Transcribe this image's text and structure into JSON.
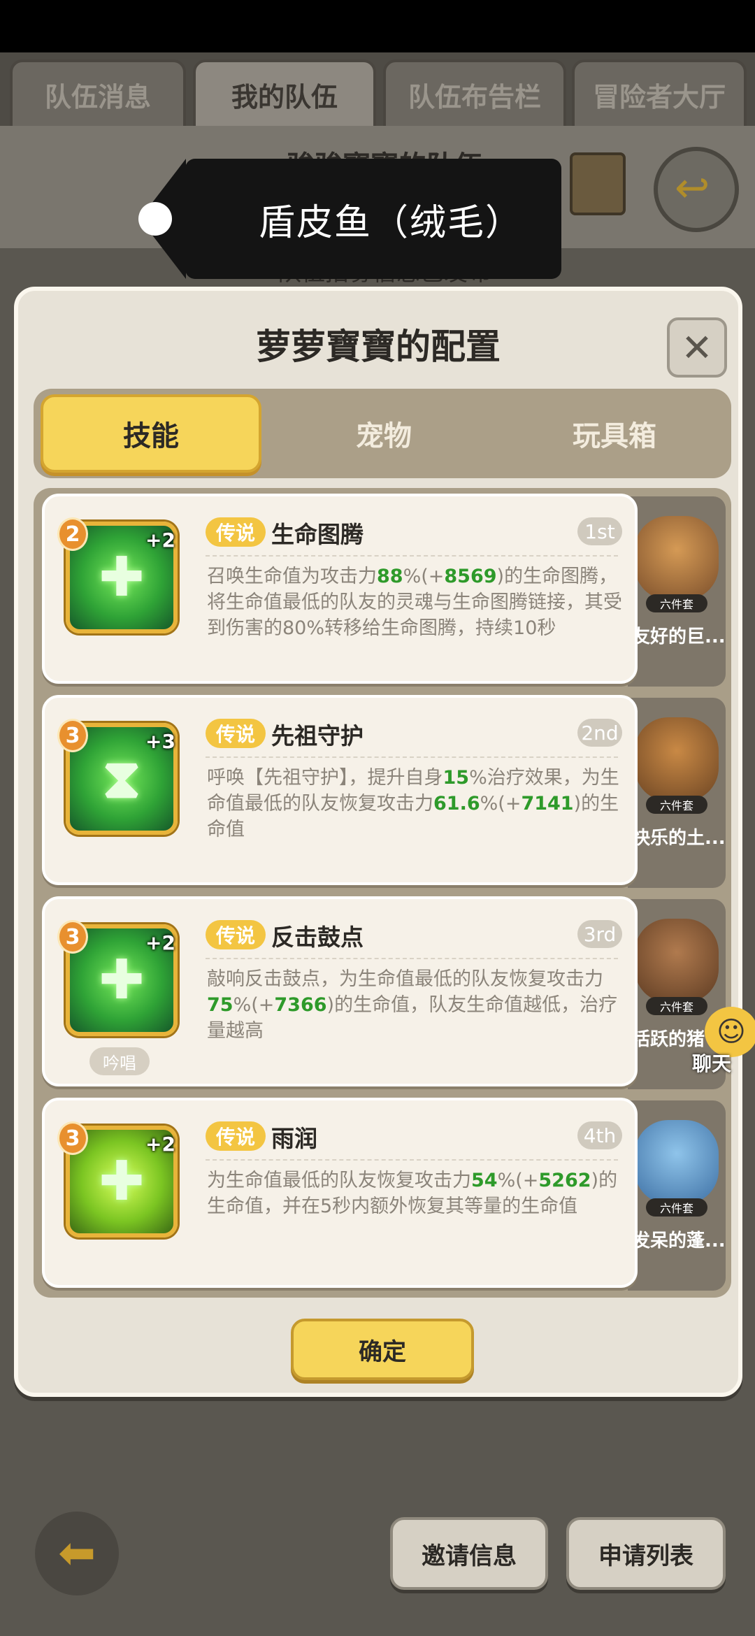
{
  "top_tabs": [
    "队伍消息",
    "我的队伍",
    "队伍布告栏",
    "冒险者大厅"
  ],
  "background": {
    "team_title": "骏骏寶寶的队伍",
    "recruit_notice": "队伍招募信息已发布"
  },
  "tooltip": {
    "text": "盾皮鱼（绒毛）"
  },
  "dialog": {
    "title": "萝萝寶寶的配置",
    "close_icon": "close-icon",
    "tabs": [
      "技能",
      "宠物",
      "玩具箱"
    ],
    "skills": [
      {
        "level": "2",
        "plus": "+2",
        "rarity": "传说",
        "name": "生命图腾",
        "rank": "1st",
        "desc_parts": [
          "召唤生命值为攻击力",
          "88",
          "%(+",
          "8569",
          ")的生命图腾，将生命值最低的队友的灵魂与生命图腾链接，其受到伤害的80%转移给生命图腾，持续10秒"
        ],
        "chip": "",
        "pet": {
          "set": "六件套",
          "name": "友好的巨..."
        }
      },
      {
        "level": "3",
        "plus": "+3",
        "rarity": "传说",
        "name": "先祖守护",
        "rank": "2nd",
        "desc_parts": [
          "呼唤【先祖守护】，提升自身",
          "15",
          "%治疗效果，为生命值最低的队友恢复攻击力",
          "61.6",
          "%(+",
          "7141",
          ")的生命值"
        ],
        "chip": "",
        "pet": {
          "set": "六件套",
          "name": "快乐的土..."
        }
      },
      {
        "level": "3",
        "plus": "+2",
        "rarity": "传说",
        "name": "反击鼓点",
        "rank": "3rd",
        "desc_parts": [
          "敲响反击鼓点，为生命值最低的队友恢复攻击力",
          "75",
          "%(+",
          "7366",
          ")的生命值，队友生命值越低，治疗量越高"
        ],
        "chip": "吟唱",
        "pet": {
          "set": "六件套",
          "name": "活跃的猪"
        }
      },
      {
        "level": "3",
        "plus": "+2",
        "rarity": "传说",
        "name": "雨润",
        "rank": "4th",
        "desc_parts": [
          "为生命值最低的队友恢复攻击力",
          "54",
          "%(+",
          "5262",
          ")的生命值，并在5秒内额外恢复其等量的生命值"
        ],
        "chip": "",
        "pet": {
          "set": "六件套",
          "name": "发呆的蓬..."
        }
      }
    ],
    "confirm_label": "确定"
  },
  "chat": {
    "label": "聊天"
  },
  "bottom": {
    "invite_label": "邀请信息",
    "apply_label": "申请列表"
  }
}
